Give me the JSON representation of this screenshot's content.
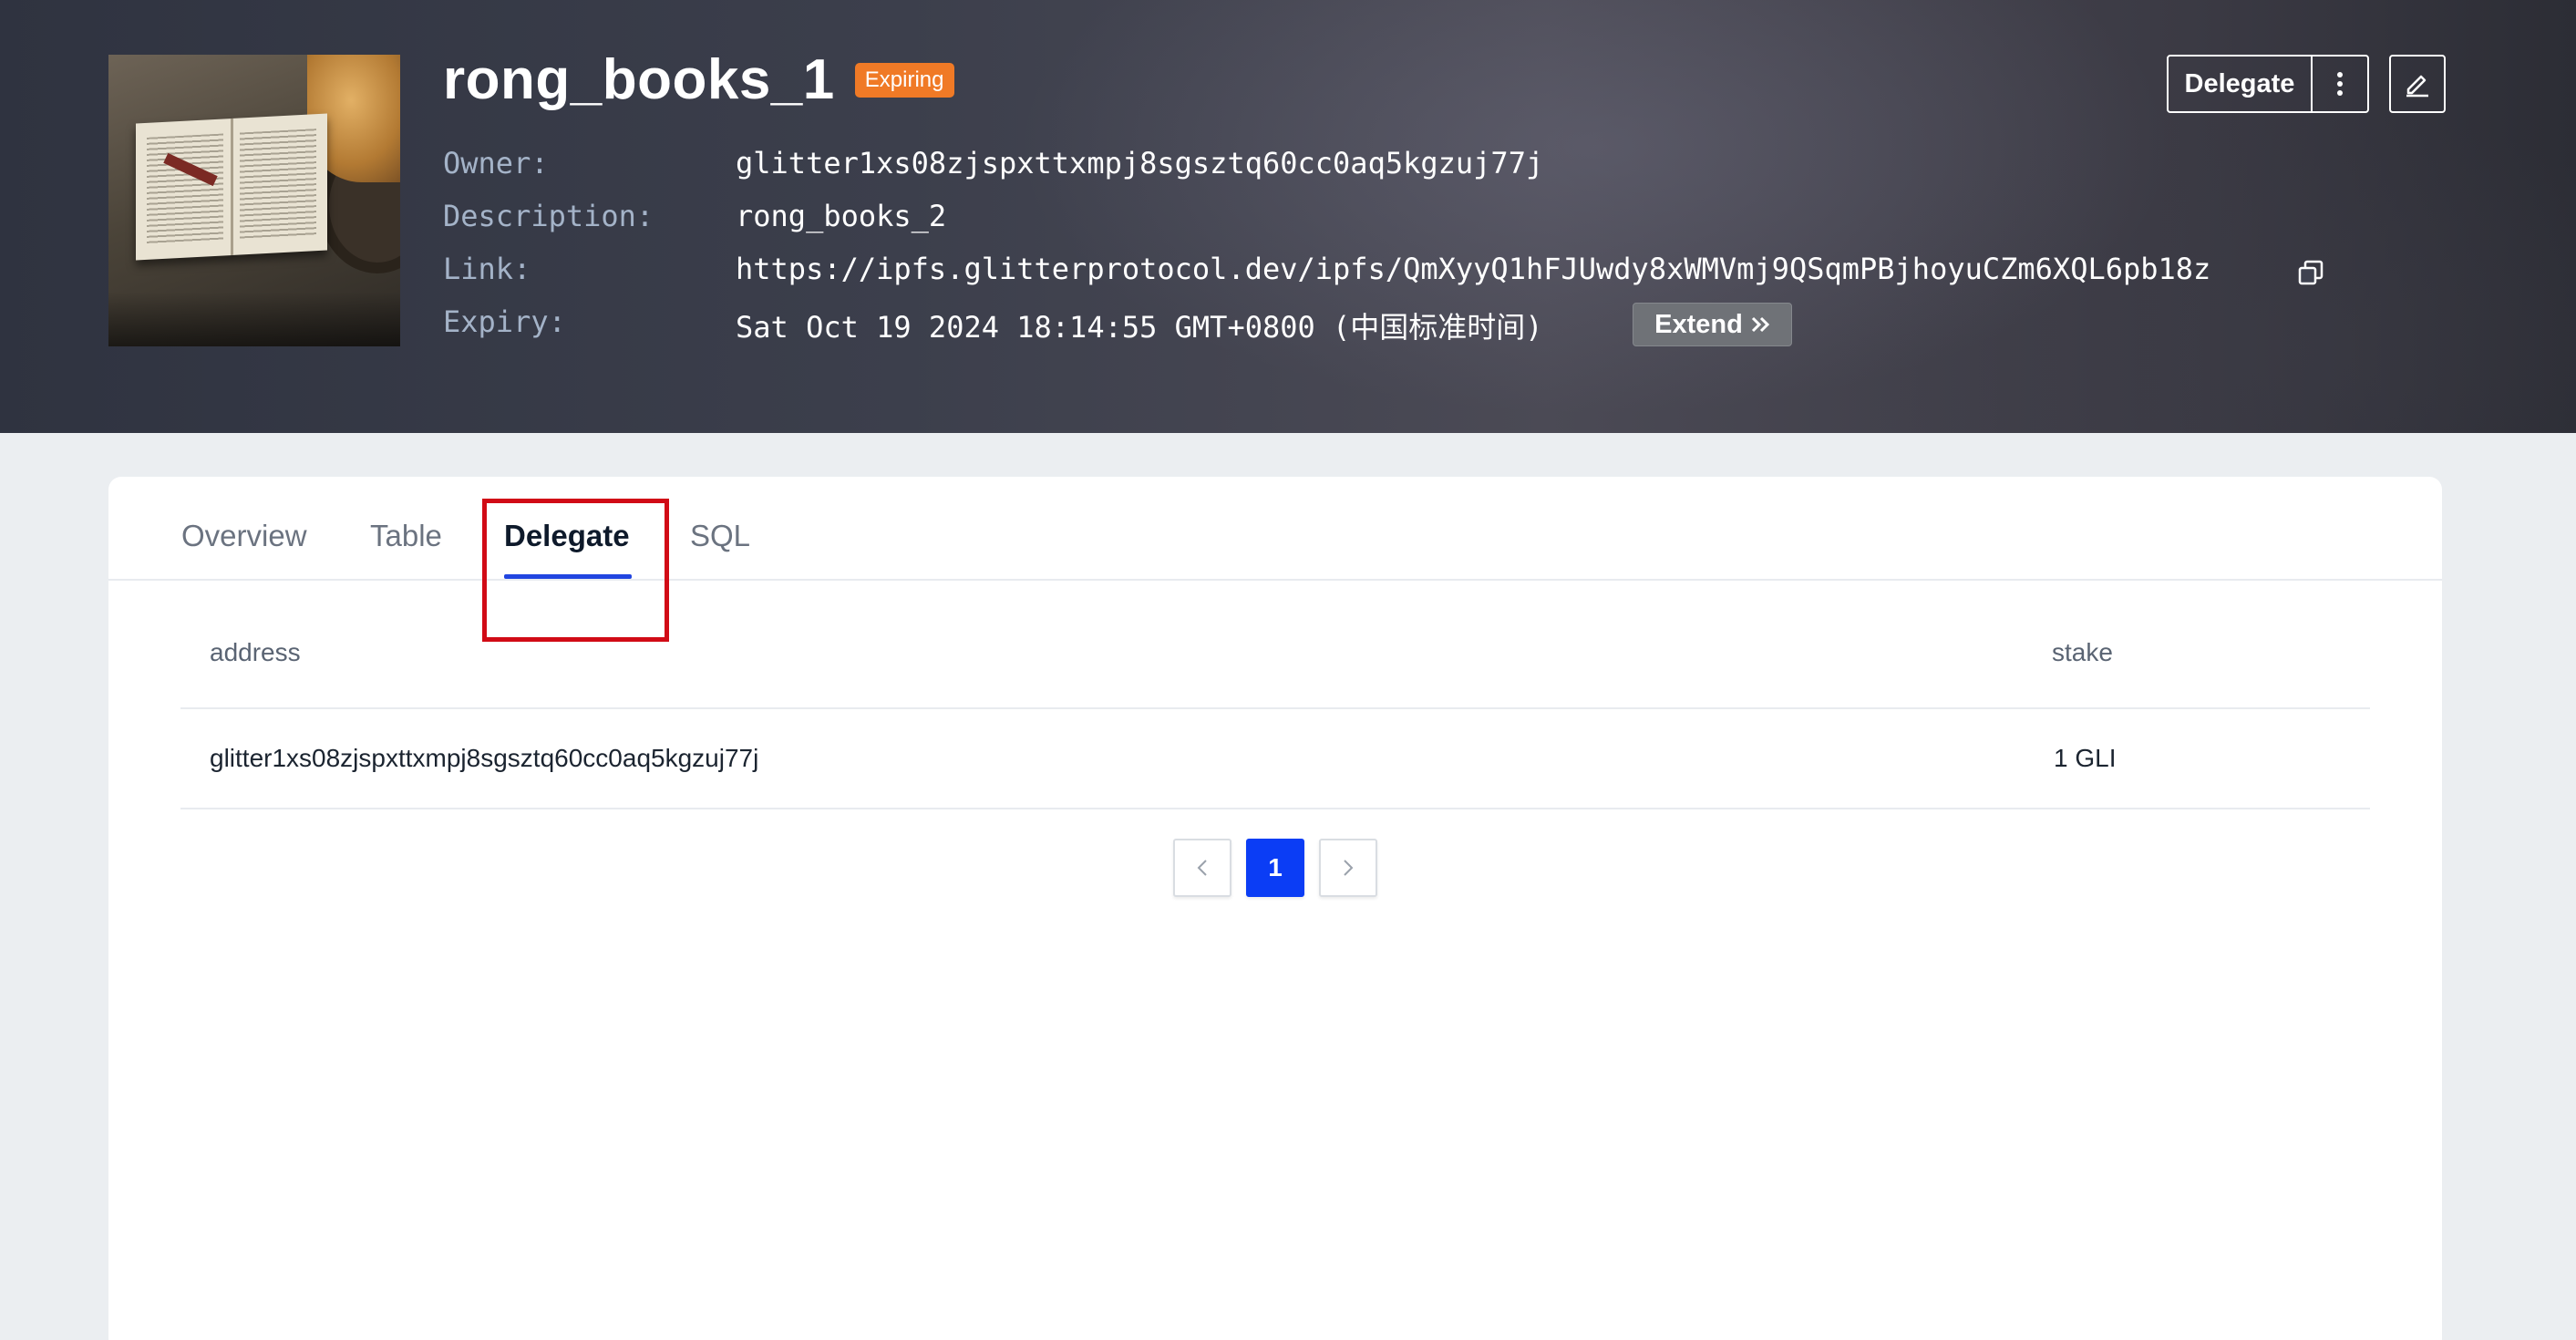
{
  "header": {
    "title": "rong_books_1",
    "badge": "Expiring",
    "owner_label": "Owner:",
    "owner_value": "glitter1xs08zjspxttxmpj8sgsztq60cc0aq5kgzuj77j",
    "description_label": "Description:",
    "description_value": "rong_books_2",
    "link_label": "Link:",
    "link_value": "https://ipfs.glitterprotocol.dev/ipfs/QmXyyQ1hFJUwdy8xWMVmj9QSqmPBjhoyuCZm6XQL6pb18z",
    "expiry_label": "Expiry:",
    "expiry_value": "Sat Oct 19 2024 18:14:55 GMT+0800 (中国标准时间)",
    "extend_label": "Extend",
    "delegate_label": "Delegate",
    "accent_color": "#f07a26"
  },
  "tabs": [
    {
      "label": "Overview",
      "active": false
    },
    {
      "label": "Table",
      "active": false
    },
    {
      "label": "Delegate",
      "active": true
    },
    {
      "label": "SQL",
      "active": false
    }
  ],
  "table": {
    "columns": [
      "address",
      "stake"
    ],
    "rows": [
      {
        "address": "glitter1xs08zjspxttxmpj8sgsztq60cc0aq5kgzuj77j",
        "stake": "1 GLI"
      }
    ]
  },
  "pagination": {
    "prev": "<",
    "current": "1",
    "next": ">"
  },
  "colors": {
    "primary": "#0b3df5",
    "tab_underline": "#2145e0",
    "highlight": "#d10b16"
  }
}
